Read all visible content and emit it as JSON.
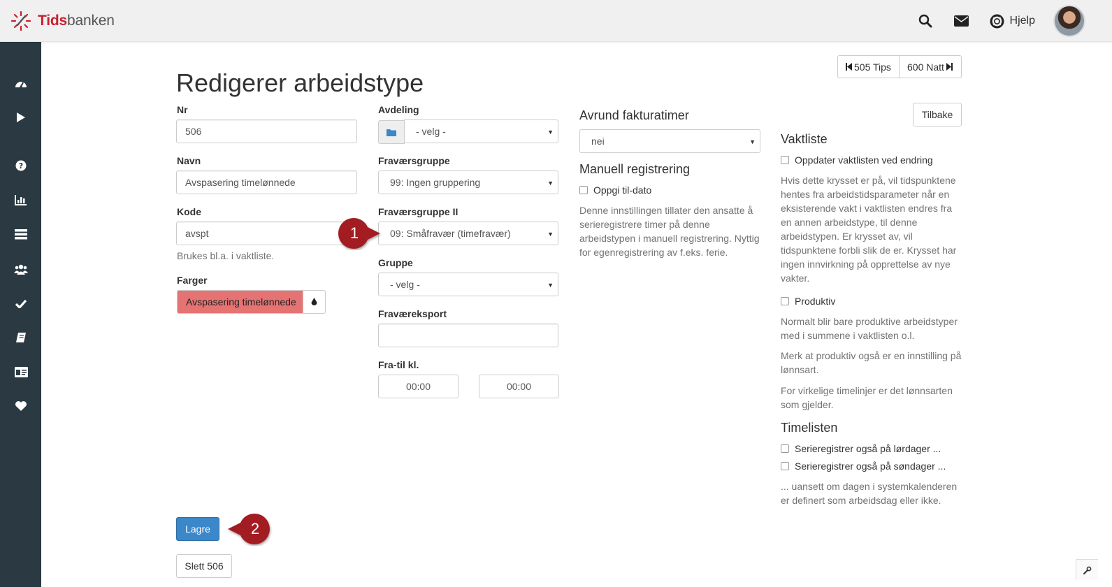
{
  "app": {
    "logo_part1": "Tids",
    "logo_part2": "banken"
  },
  "topbar": {
    "help_label": "Hjelp",
    "icons": [
      "search-icon",
      "envelope-icon",
      "lifebuoy-icon"
    ]
  },
  "sidebar": {
    "icons": [
      "dashboard-icon",
      "play-icon",
      "question-icon",
      "bar-chart-icon",
      "list-icon",
      "users-icon",
      "check-icon",
      "book-icon",
      "id-card-icon",
      "heart-icon"
    ]
  },
  "page": {
    "title": "Redigerer arbeidstype",
    "prev_label": "505 Tips",
    "next_label": "600 Natt",
    "back_label": "Tilbake"
  },
  "form": {
    "nr_label": "Nr",
    "nr_value": "506",
    "navn_label": "Navn",
    "navn_value": "Avspasering timelønnede",
    "kode_label": "Kode",
    "kode_value": "avspt",
    "kode_help": "Brukes bl.a. i vaktliste.",
    "farger_label": "Farger",
    "farger_value": "Avspasering timelønnede",
    "farger_color": "#e57373",
    "avdeling_label": "Avdeling",
    "avdeling_value": "- velg -",
    "fravaersgruppe_label": "Fraværsgruppe",
    "fravaersgruppe_value": "99: Ingen gruppering",
    "fravaersgruppe2_label": "Fraværsgruppe II",
    "fravaersgruppe2_value": "09: Småfravær (timefravær)",
    "gruppe_label": "Gruppe",
    "gruppe_value": "- velg -",
    "fravaereksport_label": "Fraværeksport",
    "fravaereksport_value": "",
    "fratil_label": "Fra-til kl.",
    "fra_value": "00:00",
    "til_value": "00:00",
    "avrund_label": "Avrund fakturatimer",
    "avrund_value": "nei",
    "manuell_label": "Manuell registrering",
    "oppgi_label": "Oppgi til-dato",
    "manuell_help": [
      "Denne innstillingen tillater den ansatte å",
      "serieregistrere timer på denne",
      "arbeidstypen i manuell registrering. Nyttig",
      "for egenregistrering av f.eks. ferie."
    ]
  },
  "vaktliste": {
    "heading": "Vaktliste",
    "oppdater_label": "Oppdater vaktlisten ved endring",
    "oppdater_help": [
      "Hvis dette krysset er på, vil tidspunktene",
      "hentes fra arbeidstidsparameter når en",
      "eksisterende vakt i vaktlisten endres fra",
      "en annen arbeidstype, til denne",
      "arbeidstypen. Er krysset av, vil",
      "tidspunktene forbli slik de er. Krysset har",
      "ingen innvirkning på opprettelse av nye",
      "vakter."
    ],
    "produktiv_label": "Produktiv",
    "produktiv_help1": [
      "Normalt blir bare produktive arbeidstyper",
      "med i summene i vaktlisten o.l."
    ],
    "produktiv_help2": [
      "Merk at produktiv også er en innstilling på",
      "lønnsart."
    ],
    "produktiv_help3": [
      "For virkelige timelinjer er det lønnsarten",
      "som gjelder."
    ]
  },
  "timelisten": {
    "heading": "Timelisten",
    "lordag_label": "Serieregistrer også på lørdager ...",
    "sondag_label": "Serieregistrer også på søndager ...",
    "help": [
      "... uansett om dagen i systemkalenderen",
      "er definert som arbeidsdag eller ikke."
    ]
  },
  "actions": {
    "save_label": "Lagre",
    "delete_label": "Slett 506"
  },
  "markers": {
    "m1": "1",
    "m2": "2",
    "color": "#a31d24"
  },
  "colors": {
    "primary": "#3a87c9",
    "sidebar": "#2b3a42",
    "brand": "#c8202f"
  }
}
